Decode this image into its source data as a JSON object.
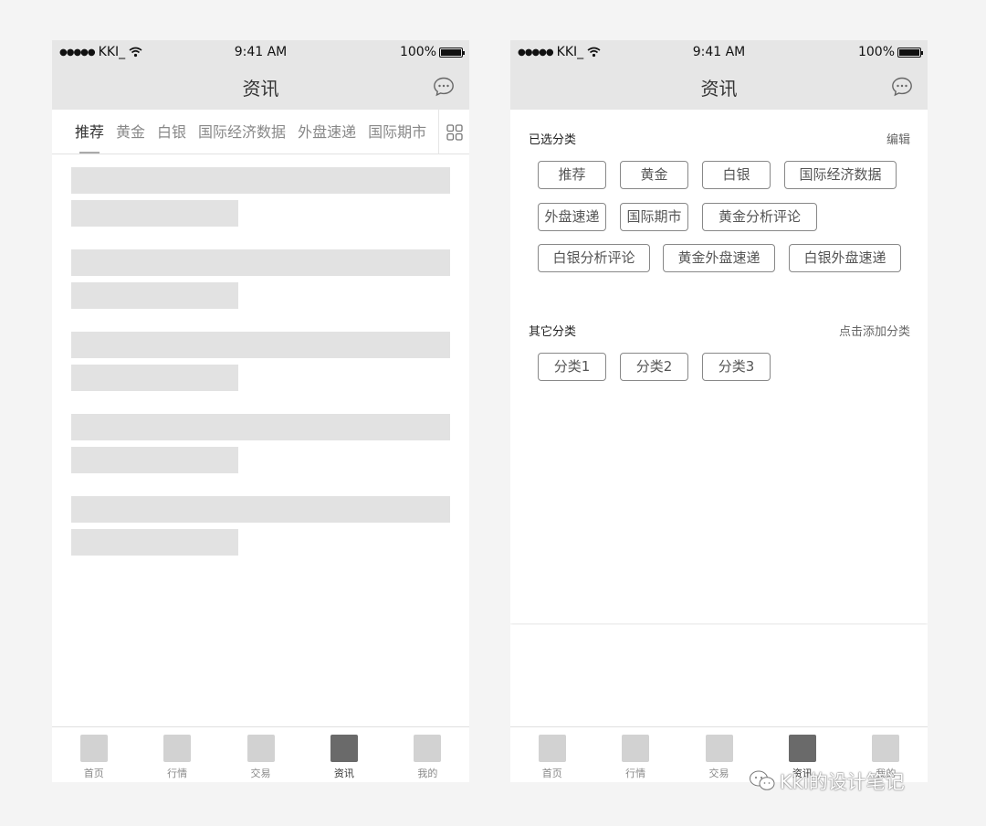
{
  "status_bar": {
    "carrier": "KKI_",
    "time": "9:41 AM",
    "battery": "100%"
  },
  "screens": {
    "left": {
      "title": "资讯",
      "tabs": [
        "推荐",
        "黄金",
        "白银",
        "国际经济数据",
        "外盘速递",
        "国际期市"
      ],
      "active_tab": "推荐"
    },
    "right": {
      "title": "资讯",
      "selected_section": {
        "title": "已选分类",
        "action": "编辑"
      },
      "selected_chips": [
        "推荐",
        "黄金",
        "白银",
        "国际经济数据",
        "外盘速递",
        "国际期市",
        "黄金分析评论",
        "白银分析评论",
        "黄金外盘速递",
        "白银外盘速递"
      ],
      "other_section": {
        "title": "其它分类",
        "action": "点击添加分类"
      },
      "other_chips": [
        "分类1",
        "分类2",
        "分类3"
      ]
    }
  },
  "tabbar": [
    "首页",
    "行情",
    "交易",
    "资讯",
    "我的"
  ],
  "tabbar_active": "资讯",
  "watermark": "Kki的设计笔记",
  "colors": {
    "header_bg": "#e6e6e6",
    "skeleton": "#e2e2e2",
    "active_tab_icon": "#6a6a6a",
    "inactive_tab_icon": "#d2d2d2"
  }
}
